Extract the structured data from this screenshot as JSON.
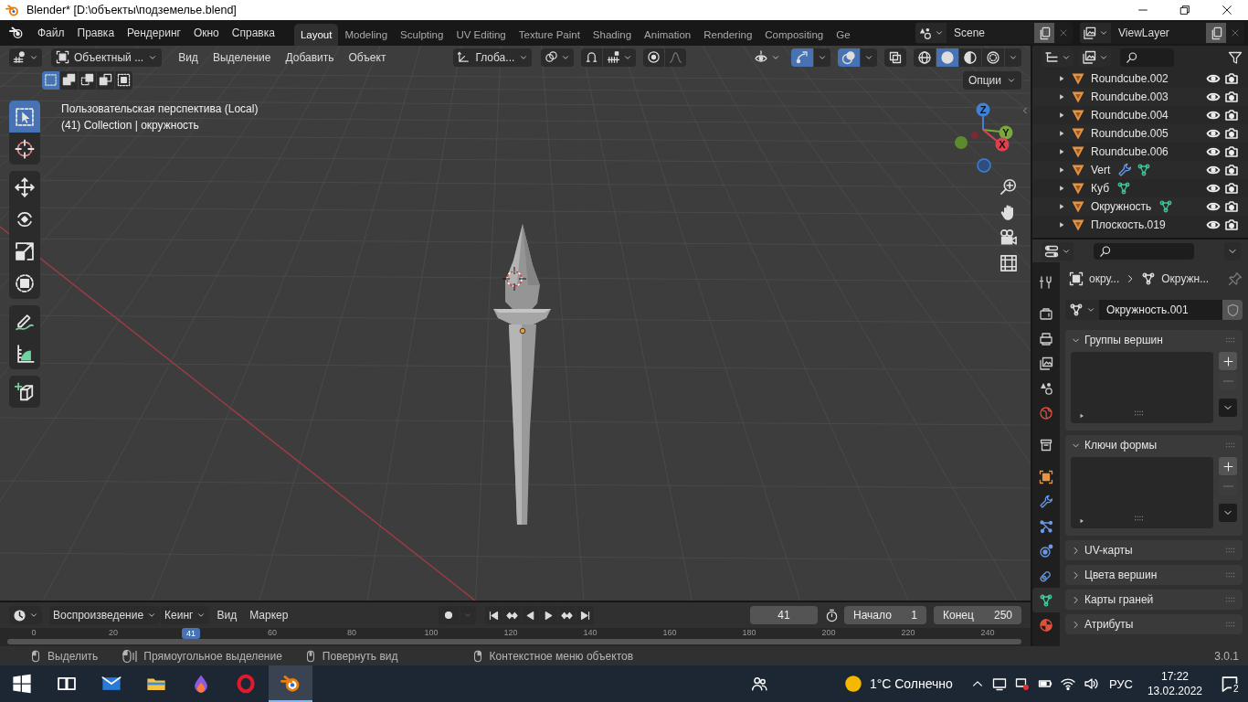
{
  "window": {
    "title": "Blender* [D:\\объекты\\подземелье.blend]"
  },
  "menu": [
    "Файл",
    "Правка",
    "Рендеринг",
    "Окно",
    "Справка"
  ],
  "workspaces": [
    {
      "label": "Layout",
      "selected": true
    },
    {
      "label": "Modeling",
      "selected": false
    },
    {
      "label": "Sculpting",
      "selected": false
    },
    {
      "label": "UV Editing",
      "selected": false
    },
    {
      "label": "Texture Paint",
      "selected": false
    },
    {
      "label": "Shading",
      "selected": false
    },
    {
      "label": "Animation",
      "selected": false
    },
    {
      "label": "Rendering",
      "selected": false
    },
    {
      "label": "Compositing",
      "selected": false
    },
    {
      "label": "Ge",
      "selected": false
    }
  ],
  "scene": {
    "name": "Scene"
  },
  "view_layer": {
    "name": "ViewLayer"
  },
  "viewport_header": {
    "mode": "Объектный ...",
    "menus": [
      "Вид",
      "Выделение",
      "Добавить",
      "Объект"
    ],
    "orientation": "Глоба...",
    "toggles": [
      {
        "kind": "gizmos",
        "on": true
      },
      {
        "kind": "overlays",
        "on": true
      },
      {
        "kind": "xray",
        "on": false
      }
    ],
    "shading": [
      {
        "kind": "wireframe",
        "selected": false
      },
      {
        "kind": "solid",
        "selected": true
      },
      {
        "kind": "material",
        "selected": false
      },
      {
        "kind": "rendered",
        "selected": false
      }
    ],
    "select_modes": [
      {
        "kind": "new",
        "selected": true
      },
      {
        "kind": "extend",
        "selected": false
      },
      {
        "kind": "subtract",
        "selected": false
      },
      {
        "kind": "invert",
        "selected": false
      },
      {
        "kind": "intersect",
        "selected": false
      }
    ],
    "options": "Опции"
  },
  "viewport": {
    "info": [
      "Пользовательская перспектива (Local)",
      "(41) Collection | окружность"
    ],
    "tool_groups": [
      [
        {
          "kind": "select",
          "selected": true
        },
        {
          "kind": "cursor",
          "selected": false
        }
      ],
      [
        {
          "kind": "move",
          "selected": false
        },
        {
          "kind": "rotate",
          "selected": false
        },
        {
          "kind": "scale",
          "selected": false
        },
        {
          "kind": "transform",
          "selected": false
        }
      ],
      [
        {
          "kind": "annotate",
          "selected": false
        },
        {
          "kind": "measure",
          "selected": false
        }
      ],
      [
        {
          "kind": "add_cube",
          "selected": false
        }
      ]
    ],
    "axis_labels": [
      "Z",
      "Y",
      "X"
    ]
  },
  "outliner": {
    "items": [
      {
        "name": "Roundcube.002",
        "visible": true,
        "renderable": true
      },
      {
        "name": "Roundcube.003",
        "visible": true,
        "renderable": true
      },
      {
        "name": "Roundcube.004",
        "visible": true,
        "renderable": true
      },
      {
        "name": "Roundcube.005",
        "visible": true,
        "renderable": true
      },
      {
        "name": "Roundcube.006",
        "visible": true,
        "renderable": true
      },
      {
        "name": "Vert",
        "badges": [
          {
            "kind": "modifier"
          },
          {
            "kind": "mesh"
          }
        ],
        "visible": true,
        "renderable": true
      },
      {
        "name": "Куб",
        "badges": [
          {
            "kind": "mesh"
          }
        ],
        "visible": true,
        "renderable": true
      },
      {
        "name": "Окружность",
        "badges": [
          {
            "kind": "mesh"
          }
        ],
        "visible": true,
        "renderable": true
      },
      {
        "name": "Плоскость.019",
        "visible": true,
        "renderable": true
      }
    ]
  },
  "properties": {
    "breadcrumb": [
      "окру...",
      "Окружн..."
    ],
    "datablock": "Окружность.001",
    "tab_groups": [
      [
        {
          "kind": "tool",
          "selected": false
        }
      ],
      [
        {
          "kind": "render",
          "selected": false
        },
        {
          "kind": "output",
          "selected": false
        },
        {
          "kind": "view_layer",
          "selected": false
        },
        {
          "kind": "scene",
          "selected": false
        },
        {
          "kind": "world",
          "selected": false
        }
      ],
      [
        {
          "kind": "collection",
          "selected": false
        }
      ],
      [
        {
          "kind": "object",
          "selected": false
        },
        {
          "kind": "modifier",
          "selected": false
        },
        {
          "kind": "particles",
          "selected": false
        },
        {
          "kind": "physics",
          "selected": false
        },
        {
          "kind": "constraints",
          "selected": false
        },
        {
          "kind": "data",
          "selected": true
        },
        {
          "kind": "material",
          "selected": false
        }
      ]
    ],
    "panels": [
      {
        "title": "Группы вершин",
        "expanded": true
      },
      {
        "title": "Ключи формы",
        "expanded": true
      },
      {
        "title": "UV-карты",
        "expanded": false
      },
      {
        "title": "Цвета вершин",
        "expanded": false
      },
      {
        "title": "Карты граней",
        "expanded": false
      },
      {
        "title": "Атрибуты",
        "expanded": false
      }
    ]
  },
  "timeline": {
    "menus": [
      {
        "label": "Воспроизведение",
        "kind": "dropdown"
      },
      {
        "label": "Кеинг",
        "kind": "dropdown"
      },
      {
        "label": "Вид",
        "kind": "menu"
      },
      {
        "label": "Маркер",
        "kind": "menu"
      }
    ],
    "current_frame": "41",
    "start": {
      "label": "Начало",
      "value": "1"
    },
    "end": {
      "label": "Конец",
      "value": "250"
    },
    "ruler": [
      "0",
      "20",
      "60",
      "80",
      "100",
      "120",
      "140",
      "160",
      "180",
      "200",
      "220",
      "240"
    ],
    "playhead": "41"
  },
  "status_bar": {
    "hints": [
      {
        "kind": "left",
        "text": "Выделить"
      },
      {
        "kind": "left_drag",
        "text": "Прямоугольное выделение"
      },
      {
        "kind": "middle",
        "text": "Повернуть вид"
      },
      {
        "kind": "right",
        "text": "Контекстное меню объектов"
      }
    ],
    "version": "3.0.1"
  },
  "taskbar": {
    "apps": [
      {
        "kind": "start",
        "selected": false
      },
      {
        "kind": "task_view",
        "selected": false
      },
      {
        "kind": "mail",
        "selected": false
      },
      {
        "kind": "explorer",
        "selected": false
      },
      {
        "kind": "drop",
        "selected": false
      },
      {
        "kind": "opera",
        "selected": false
      },
      {
        "kind": "blender",
        "selected": true
      }
    ],
    "weather": "1°C Солнечно",
    "language": "РУС",
    "time": "17:22",
    "date": "13.02.2022",
    "notifications": "2"
  }
}
